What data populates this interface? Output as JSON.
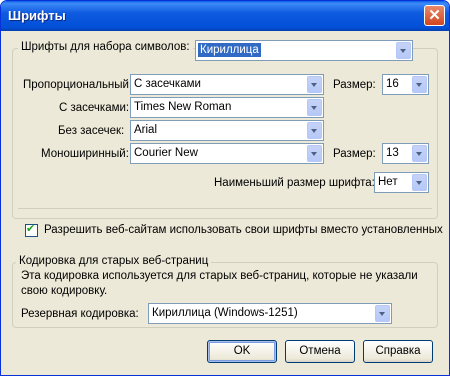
{
  "window": {
    "title": "Шрифты",
    "close_glyph": "✕"
  },
  "charset": {
    "label": "Шрифты для набора символов:",
    "value": "Кириллица"
  },
  "fonts": {
    "proportional": {
      "label": "Пропорциональный",
      "value": "С засечками",
      "size_label": "Размер:",
      "size_value": "16"
    },
    "serif": {
      "label": "С засечками:",
      "value": "Times New Roman"
    },
    "sans": {
      "label": "Без засечек:",
      "value": "Arial"
    },
    "mono": {
      "label": "Моноширинный:",
      "value": "Courier New",
      "size_label": "Размер:",
      "size_value": "13"
    },
    "min_size": {
      "label": "Наименьший размер шрифта:",
      "value": "Нет"
    }
  },
  "allow_fonts": {
    "label": "Разрешить веб-сайтам использовать свои шрифты вместо установленных",
    "checked": true
  },
  "encoding": {
    "title": "Кодировка для старых веб-страниц",
    "description_line1": "Эта кодировка используется для старых веб-страниц, которые не указали",
    "description_line2": "свою кодировку.",
    "label": "Резервная кодировка:",
    "value": "Кириллица (Windows-1251)"
  },
  "buttons": {
    "ok": "OK",
    "cancel": "Отмена",
    "help": "Справка"
  }
}
